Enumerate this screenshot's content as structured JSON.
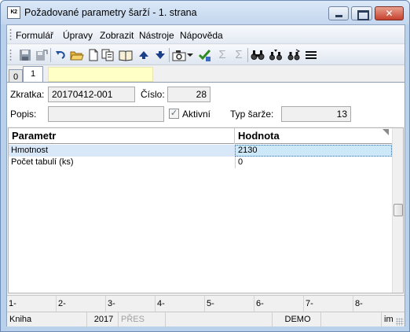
{
  "window": {
    "title": "Požadované parametry šarží - 1. strana",
    "icon_text": "K2"
  },
  "menu": [
    "Formulář",
    "Úpravy",
    "Zobrazit",
    "Nástroje",
    "Nápověda"
  ],
  "toolbar": {
    "icons": [
      "save-icon",
      "save-as-icon",
      "undo-icon",
      "open-folder-icon",
      "new-document-icon",
      "copy-icon",
      "book-icon",
      "arrow-up-icon",
      "arrow-down-icon",
      "camera-icon",
      "dropdown-arrow-icon",
      "checkmark-icon",
      "sigma-icon",
      "sigma-filter-icon",
      "find-icon",
      "find-next-icon",
      "find-options-icon",
      "menu-lines-icon"
    ]
  },
  "tabs": {
    "tab0": "0",
    "tab1": "1"
  },
  "form": {
    "zkratka_label": "Zkratka:",
    "zkratka_value": "20170412-001",
    "cislo_label": "Číslo:",
    "cislo_value": "28",
    "popis_label": "Popis:",
    "popis_value": "",
    "aktivni_label": "Aktivní",
    "aktivni_checked": "✓",
    "typ_label": "Typ šarže:",
    "typ_value": "13"
  },
  "grid": {
    "headers": [
      "Parametr",
      "Hodnota"
    ],
    "rows": [
      {
        "parametr": "Hmotnost",
        "hodnota": "2130"
      },
      {
        "parametr": "Počet tabulí (ks)",
        "hodnota": "0"
      }
    ]
  },
  "fkeys": [
    "1-",
    "2-",
    "3-",
    "4-",
    "5-",
    "6-",
    "7-",
    "8-"
  ],
  "status": {
    "module": "Kniha",
    "year": "2017",
    "mode": "PŘES",
    "db": "DEMO",
    "extra": "im"
  },
  "colors": {
    "selected_row": "#d9e8f9",
    "selected_cell": "#cde8f8",
    "tab_yellow": "#ffffc6"
  }
}
